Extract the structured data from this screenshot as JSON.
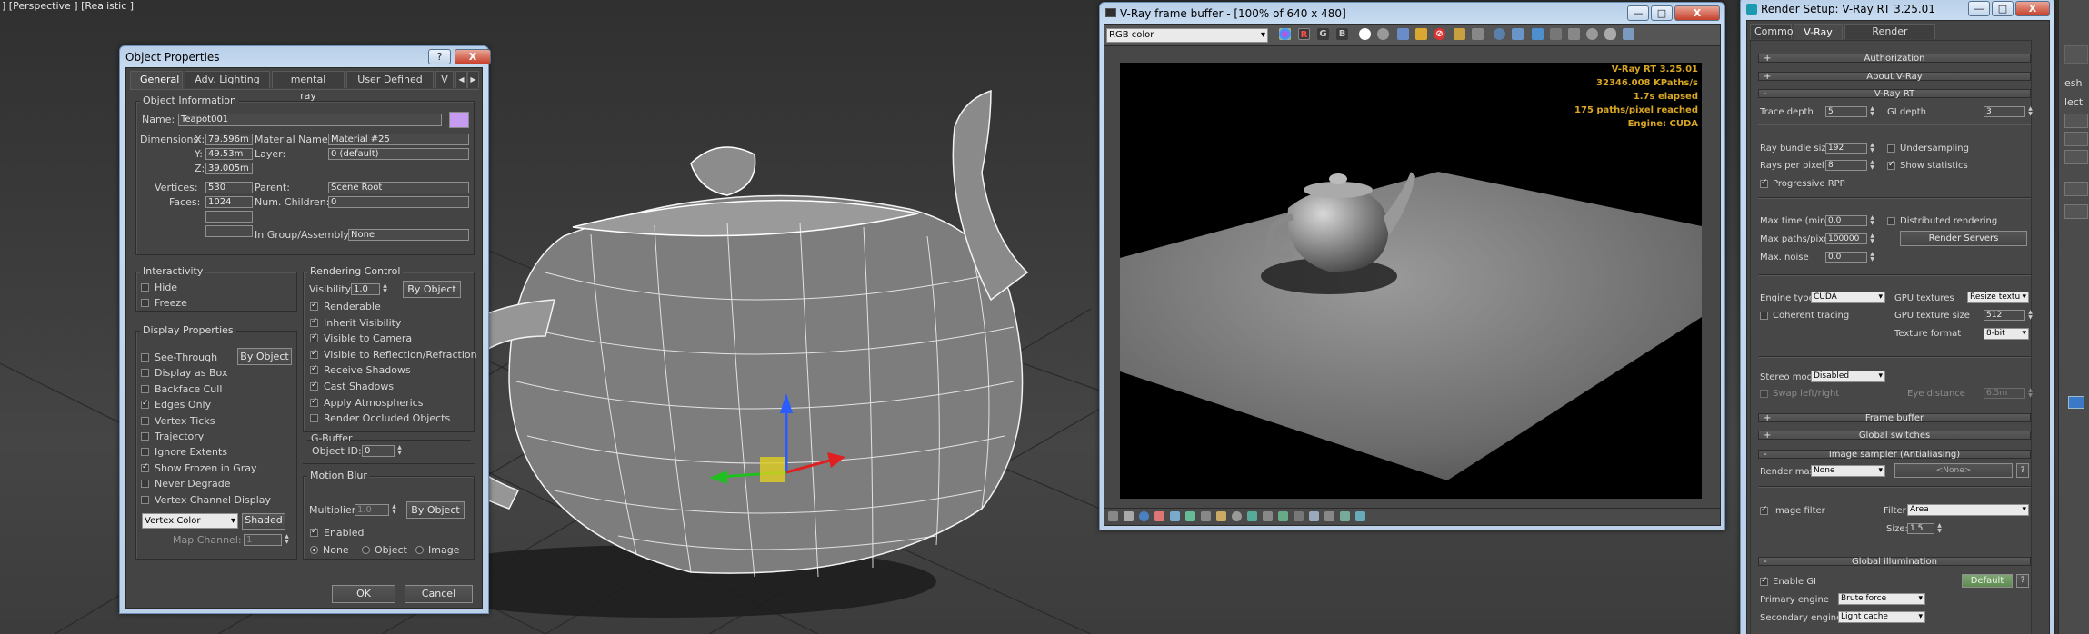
{
  "viewport": {
    "label": "] [Perspective ] [Realistic ]"
  },
  "object_properties": {
    "title": "Object Properties",
    "title_buttons": {
      "help": "?",
      "close": "X"
    },
    "tabs": [
      "General",
      "Adv. Lighting",
      "mental ray",
      "User Defined",
      "V"
    ],
    "object_info": {
      "label": "Object Information",
      "name_label": "Name:",
      "name": "Teapot001",
      "color": "#c79cf0",
      "dimensions_label": "Dimensions:",
      "x_label": "X:",
      "x": "79.596m",
      "y_label": "Y:",
      "y": "49.53m",
      "z_label": "Z:",
      "z": "39.005m",
      "material_label": "Material Name:",
      "material": "Material #25",
      "layer_label": "Layer:",
      "layer": "0 (default)",
      "vertices_label": "Vertices:",
      "vertices": "530",
      "faces_label": "Faces:",
      "faces": "1024",
      "parent_label": "Parent:",
      "parent": "Scene Root",
      "children_label": "Num. Children:",
      "children": "0",
      "group_label": "In Group/Assembly:",
      "group": "None"
    },
    "interactivity": {
      "label": "Interactivity",
      "hide": "Hide",
      "freeze": "Freeze"
    },
    "display_properties": {
      "label": "Display Properties",
      "by_object": "By Object",
      "items": [
        {
          "label": "See-Through",
          "checked": false
        },
        {
          "label": "Display as Box",
          "checked": false
        },
        {
          "label": "Backface Cull",
          "checked": false
        },
        {
          "label": "Edges Only",
          "checked": true
        },
        {
          "label": "Vertex Ticks",
          "checked": false
        },
        {
          "label": "Trajectory",
          "checked": false
        },
        {
          "label": "Ignore Extents",
          "checked": false
        },
        {
          "label": "Show Frozen in Gray",
          "checked": true
        },
        {
          "label": "Never Degrade",
          "checked": false
        },
        {
          "label": "Vertex Channel Display",
          "checked": false
        }
      ],
      "vertex_color": "Vertex Color",
      "shaded": "Shaded",
      "map_channel_label": "Map Channel:",
      "map_channel": "1"
    },
    "rendering_control": {
      "label": "Rendering Control",
      "visibility_label": "Visibility:",
      "visibility": "1.0",
      "by_object": "By Object",
      "items": [
        {
          "label": "Renderable",
          "checked": true
        },
        {
          "label": "Inherit Visibility",
          "checked": true
        },
        {
          "label": "Visible to Camera",
          "checked": true
        },
        {
          "label": "Visible to Reflection/Refraction",
          "checked": true
        },
        {
          "label": "Receive Shadows",
          "checked": true
        },
        {
          "label": "Cast Shadows",
          "checked": true
        },
        {
          "label": "Apply Atmospherics",
          "checked": true
        },
        {
          "label": "Render Occluded Objects",
          "checked": false
        }
      ]
    },
    "gbuffer": {
      "label": "G-Buffer",
      "object_id_label": "Object ID:",
      "object_id": "0"
    },
    "motion_blur": {
      "label": "Motion Blur",
      "multiplier_label": "Multiplier:",
      "multiplier": "1.0",
      "by_object": "By Object",
      "enabled": "Enabled",
      "options": [
        "None",
        "Object",
        "Image"
      ]
    },
    "ok": "OK",
    "cancel": "Cancel"
  },
  "frame_buffer": {
    "title": "V-Ray frame buffer - [100% of 640 x 480]",
    "channel": "RGB color",
    "stats": [
      "V-Ray RT 3.25.01",
      "32346.008 KPaths/s",
      "1.7s elapsed",
      "175 paths/pixel reached",
      "Engine: CUDA"
    ]
  },
  "render_setup": {
    "title": "Render Setup: V-Ray RT 3.25.01",
    "tabs": [
      "Common",
      "V-Ray RT",
      "Render Elements"
    ],
    "rollouts": [
      "Authorization",
      "About V-Ray",
      "V-Ray RT"
    ],
    "trace_depth_label": "Trace depth",
    "trace_depth": "5",
    "gi_depth_label": "GI depth",
    "gi_depth": "3",
    "ray_bundle_label": "Ray bundle size",
    "ray_bundle": "192",
    "undersampling": "Undersampling",
    "rays_per_pixel_label": "Rays per pixel",
    "rays_per_pixel": "8",
    "show_statistics": "Show statistics",
    "progressive_rpp": "Progressive RPP",
    "max_time_label": "Max time (min)",
    "max_time": "0.0",
    "distributed": "Distributed rendering",
    "max_paths_label": "Max paths/pixel",
    "max_paths": "100000",
    "render_servers": "Render Servers",
    "max_noise_label": "Max. noise",
    "max_noise": "0.0",
    "engine_type_label": "Engine type",
    "engine_type": "CUDA",
    "gpu_textures_label": "GPU textures",
    "gpu_textures": "Resize textu",
    "coherent": "Coherent tracing",
    "gpu_tex_size_label": "GPU texture size",
    "gpu_tex_size": "512",
    "tex_format_label": "Texture format",
    "tex_format": "8-bit",
    "stereo_label": "Stereo mode",
    "stereo": "Disabled",
    "swap": "Swap left/right",
    "eye_label": "Eye distance",
    "eye": "6.5m",
    "rollouts2": [
      "Frame buffer",
      "Global switches",
      "Image sampler (Antialiasing)"
    ],
    "render_mask_label": "Render mask",
    "render_mask": "None",
    "render_mask_none": "<None>",
    "image_filter": "Image filter",
    "filter_label": "Filter",
    "filter": "Area",
    "size_label": "Size:",
    "size": "1.5",
    "gi_rollout": "Global illumination",
    "enable_gi": "Enable GI",
    "default": "Default",
    "primary_label": "Primary engine",
    "primary": "Brute force",
    "secondary_label": "Secondary engine",
    "secondary": "Light cache"
  },
  "right_edge": {
    "labels": [
      "esh",
      "lect"
    ]
  }
}
